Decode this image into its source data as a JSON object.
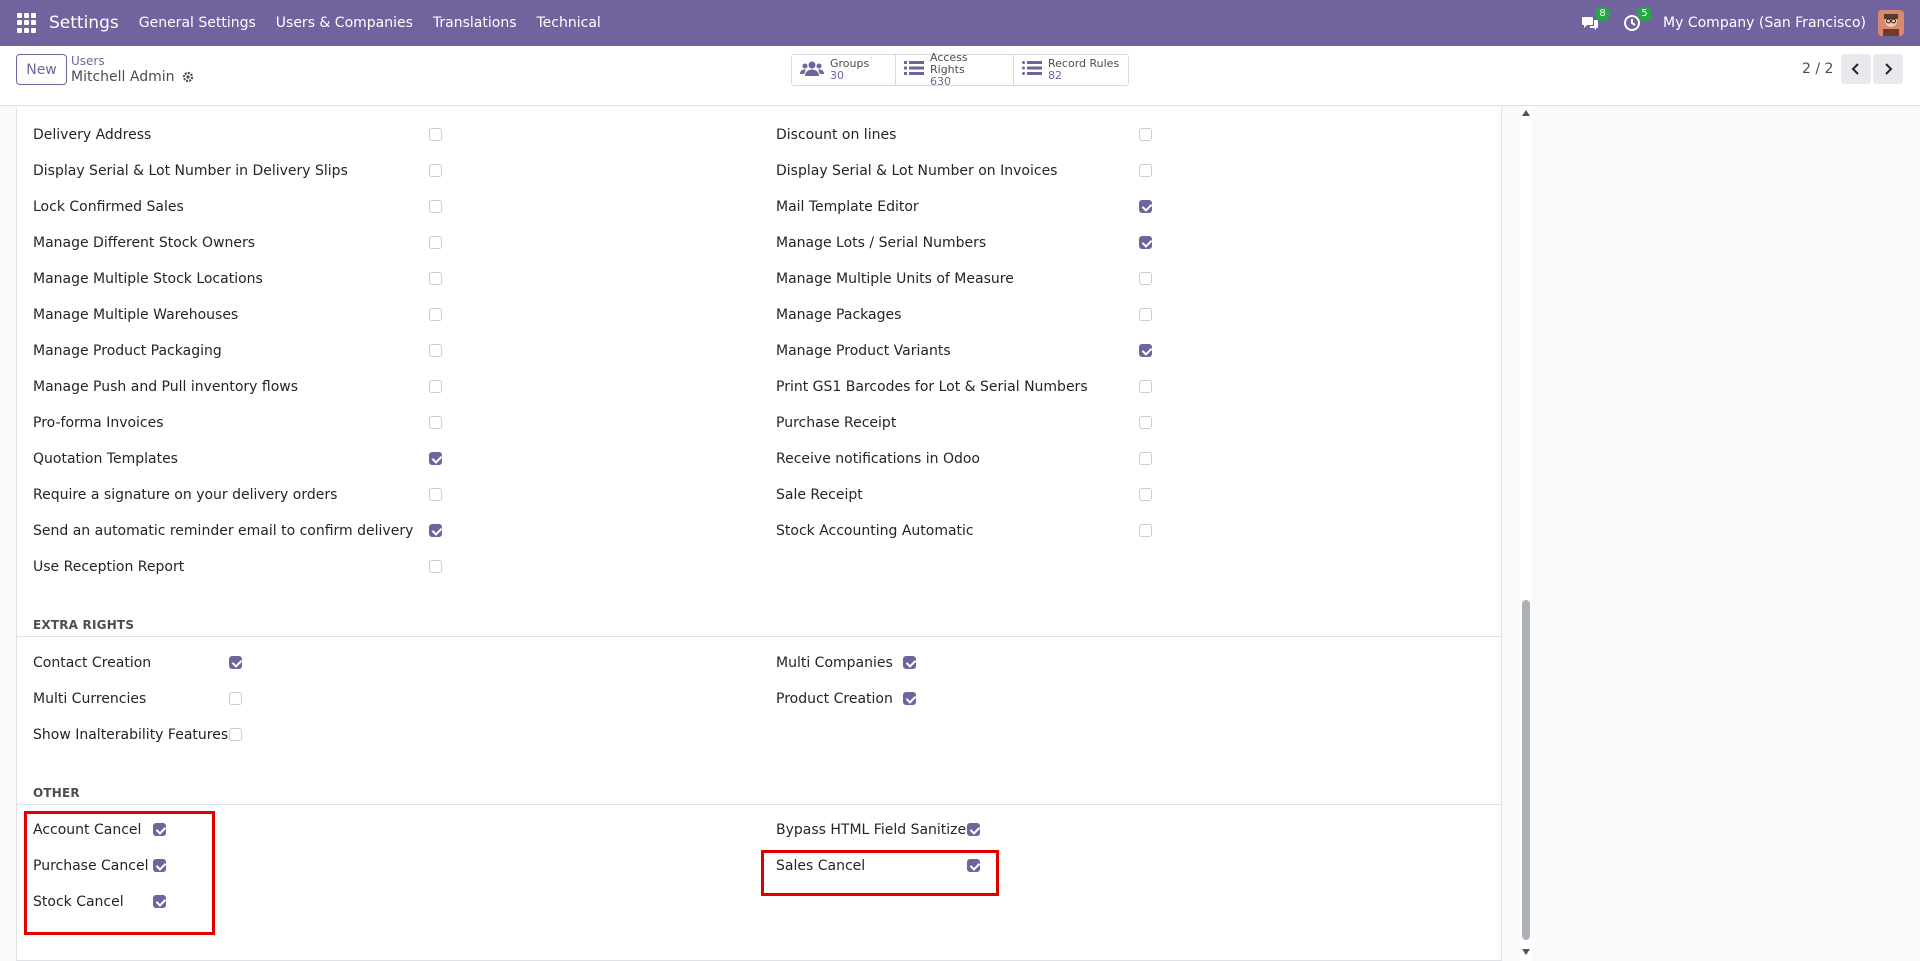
{
  "navbar": {
    "brand": "Settings",
    "menu": [
      "General Settings",
      "Users & Companies",
      "Translations",
      "Technical"
    ],
    "messages_count": "8",
    "activities_count": "5",
    "company": "My Company (San Francisco)"
  },
  "control_panel": {
    "new_label": "New",
    "breadcrumb_parent": "Users",
    "breadcrumb_current": "Mitchell Admin",
    "smart_buttons": [
      {
        "label": "Groups",
        "value": "30",
        "icon": "users-icon"
      },
      {
        "label": "Access Rights",
        "value": "630",
        "icon": "list-icon"
      },
      {
        "label": "Record Rules",
        "value": "82",
        "icon": "list-icon"
      }
    ],
    "pager": "2 / 2"
  },
  "technical_left": [
    {
      "label": "Delivery Address",
      "checked": false
    },
    {
      "label": "Display Serial & Lot Number in Delivery Slips",
      "checked": false
    },
    {
      "label": "Lock Confirmed Sales",
      "checked": false
    },
    {
      "label": "Manage Different Stock Owners",
      "checked": false
    },
    {
      "label": "Manage Multiple Stock Locations",
      "checked": false
    },
    {
      "label": "Manage Multiple Warehouses",
      "checked": false
    },
    {
      "label": "Manage Product Packaging",
      "checked": false
    },
    {
      "label": "Manage Push and Pull inventory flows",
      "checked": false
    },
    {
      "label": "Pro-forma Invoices",
      "checked": false
    },
    {
      "label": "Quotation Templates",
      "checked": true
    },
    {
      "label": "Require a signature on your delivery orders",
      "checked": false
    },
    {
      "label": "Send an automatic reminder email to confirm delivery",
      "checked": true
    },
    {
      "label": "Use Reception Report",
      "checked": false
    }
  ],
  "technical_right": [
    {
      "label": "Discount on lines",
      "checked": false
    },
    {
      "label": "Display Serial & Lot Number on Invoices",
      "checked": false
    },
    {
      "label": "Mail Template Editor",
      "checked": true
    },
    {
      "label": "Manage Lots / Serial Numbers",
      "checked": true
    },
    {
      "label": "Manage Multiple Units of Measure",
      "checked": false
    },
    {
      "label": "Manage Packages",
      "checked": false
    },
    {
      "label": "Manage Product Variants",
      "checked": true
    },
    {
      "label": "Print GS1 Barcodes for Lot & Serial Numbers",
      "checked": false
    },
    {
      "label": "Purchase Receipt",
      "checked": false
    },
    {
      "label": "Receive notifications in Odoo",
      "checked": false
    },
    {
      "label": "Sale Receipt",
      "checked": false
    },
    {
      "label": "Stock Accounting Automatic",
      "checked": false
    }
  ],
  "extra_rights": {
    "title": "EXTRA RIGHTS",
    "left": [
      {
        "label": "Contact Creation",
        "checked": true
      },
      {
        "label": "Multi Currencies",
        "checked": false
      },
      {
        "label": "Show Inalterability Features",
        "checked": false
      }
    ],
    "right": [
      {
        "label": "Multi Companies",
        "checked": true
      },
      {
        "label": "Product Creation",
        "checked": true
      }
    ]
  },
  "other": {
    "title": "OTHER",
    "left": [
      {
        "label": "Account Cancel",
        "checked": true
      },
      {
        "label": "Purchase Cancel",
        "checked": true
      },
      {
        "label": "Stock Cancel",
        "checked": true
      }
    ],
    "right": [
      {
        "label": "Bypass HTML Field Sanitize",
        "checked": true
      },
      {
        "label": "Sales Cancel",
        "checked": true
      }
    ]
  },
  "colors": {
    "navbar": "#71639e",
    "accent": "#71639e",
    "highlight": "#e00000",
    "badge": "#28a745"
  }
}
